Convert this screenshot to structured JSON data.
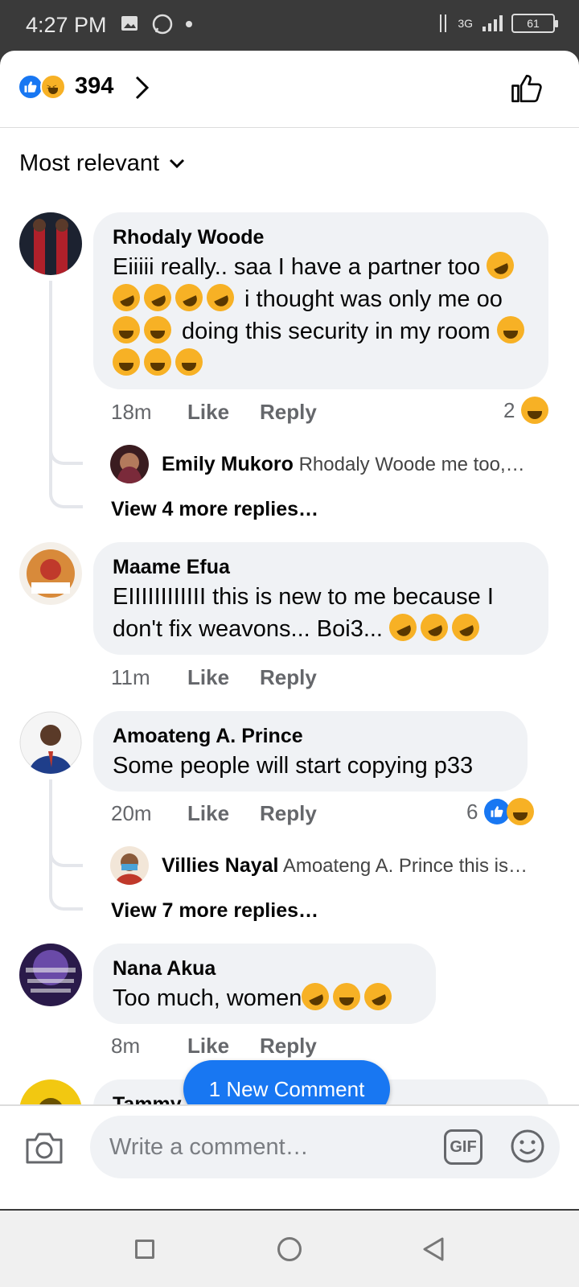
{
  "status_bar": {
    "time": "4:27 PM",
    "network": "3G",
    "battery": "61"
  },
  "header": {
    "reaction_count": "394"
  },
  "sort": {
    "label": "Most relevant"
  },
  "comments": [
    {
      "author": "Rhodaly Woode",
      "text_parts": [
        "Eiiiii really.. saa I have a partner too",
        " i thought was only me oo",
        " doing this security in my room"
      ],
      "time": "18m",
      "like": "Like",
      "reply": "Reply",
      "reactions": "2",
      "reply_preview": {
        "author": "Emily Mukoro",
        "text": "Rhodaly Woode me too,…"
      },
      "more_replies": "View 4 more replies…"
    },
    {
      "author": "Maame Efua",
      "text": "EIIIIIIIIIIII this is new to me because I don't fix weavons... Boi3...",
      "time": "11m",
      "like": "Like",
      "reply": "Reply"
    },
    {
      "author": "Amoateng A. Prince",
      "text": "Some people will start copying p33",
      "time": "20m",
      "like": "Like",
      "reply": "Reply",
      "reactions": "6",
      "reply_preview": {
        "author": "Villies Nayal",
        "text": "Amoateng A. Prince this is…"
      },
      "more_replies": "View 7 more replies…"
    },
    {
      "author": "Nana Akua",
      "text": "Too much, women",
      "time": "8m",
      "like": "Like",
      "reply": "Reply"
    },
    {
      "author": "Tammy Lee"
    }
  ],
  "new_comment_button": "1 New Comment",
  "composer": {
    "placeholder": "Write a comment…",
    "gif": "GIF"
  },
  "icons": [
    "like-reaction-icon",
    "haha-reaction-icon",
    "chevron-right-icon",
    "thumbs-up-icon",
    "chevron-down-icon",
    "camera-icon",
    "gif-icon",
    "emoji-icon"
  ],
  "colors": {
    "accent": "#1877f2",
    "bubble": "#f0f2f5",
    "meta": "#65676b"
  }
}
